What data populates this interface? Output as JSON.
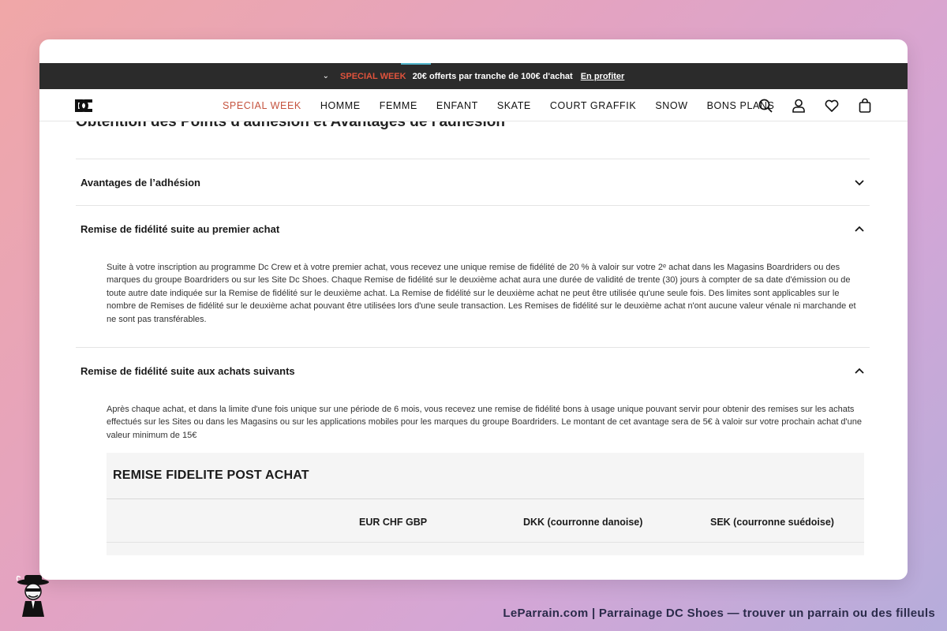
{
  "promo": {
    "special_label": "SPECIAL WEEK",
    "offer_text": "20€ offerts par tranche de 100€ d'achat",
    "link_text": "En profiter"
  },
  "nav": {
    "items": [
      {
        "label": "SPECIAL WEEK"
      },
      {
        "label": "HOMME"
      },
      {
        "label": "FEMME"
      },
      {
        "label": "ENFANT"
      },
      {
        "label": "SKATE"
      },
      {
        "label": "COURT GRAFFIK"
      },
      {
        "label": "SNOW"
      },
      {
        "label": "BONS PLANS"
      }
    ],
    "icons": [
      "search-icon",
      "account-icon",
      "heart-icon",
      "bag-icon"
    ]
  },
  "content": {
    "section_title": "Obtention des Points d'adhésion et Avantages de l'adhésion",
    "accordion": [
      {
        "title": "Avantages de l’adhésion",
        "state": "collapsed"
      },
      {
        "title": "Remise de fidélité suite au premier achat",
        "state": "expanded",
        "body": "Suite à votre inscription au programme Dc Crew et à votre premier achat, vous recevez une unique remise de fidélité de 20 % à valoir sur votre 2ᵉ achat dans les Magasins Boardriders ou des marques du groupe Boardriders ou sur les Site Dc Shoes. Chaque Remise de fidélité sur le deuxième achat aura une durée de validité de trente (30) jours à compter de sa date d'émission ou de toute autre date indiquée sur la Remise de fidélité sur le deuxième achat. La Remise de fidélité sur le deuxième achat ne peut être utilisée qu'une seule fois. Des limites sont applicables sur le nombre de Remises de fidélité sur le deuxième achat pouvant être utilisées lors d'une seule transaction.  Les Remises de fidélité sur le deuxième achat n'ont aucune valeur vénale ni marchande et ne sont pas transférables."
      },
      {
        "title": "Remise de fidélité suite aux achats suivants",
        "state": "expanded",
        "body": "Après chaque achat, et dans la limite d'une fois unique sur une période de 6 mois, vous recevez une remise de fidélité bons à usage unique pouvant servir pour obtenir des remises sur les achats effectués sur les Sites ou dans les Magasins ou sur les applications mobiles pour les marques du groupe Boardriders.  Le montant de cet avantage sera de 5€ à valoir sur votre prochain achat d'une valeur minimum de 15€"
      }
    ],
    "table": {
      "title": "REMISE FIDELITE POST ACHAT",
      "columns": [
        "EUR CHF GBP",
        "DKK (courronne danoise)",
        "SEK (courronne suédoise)"
      ]
    }
  },
  "watermark": "LeParrain.com | Parrainage DC Shoes — trouver un parrain ou des filleuls",
  "colors": {
    "promo_bg": "#2b2b2b",
    "special": "#c5533e",
    "table_bg": "#f5f5f5"
  }
}
